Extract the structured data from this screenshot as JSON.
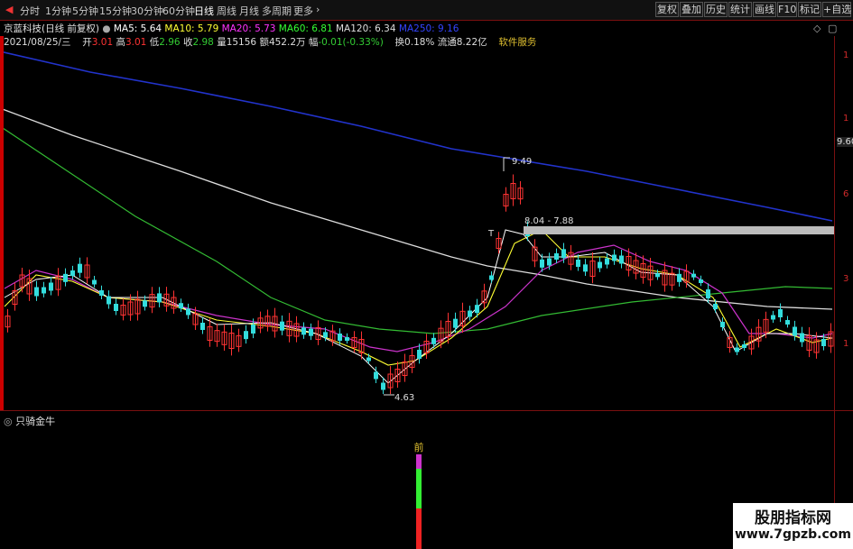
{
  "toolbar": {
    "timeframes": [
      "分时",
      "1分钟",
      "5分钟",
      "15分钟",
      "30分钟",
      "60分钟",
      "日线",
      "周线",
      "月线",
      "多周期",
      "更多"
    ],
    "active": "日线",
    "right_buttons": [
      "复权",
      "叠加",
      "历史",
      "统计",
      "画线",
      "F10",
      "标记",
      "+自选"
    ]
  },
  "info": {
    "title": "京蓝科技(日线 前复权)",
    "ma": [
      {
        "text": "MA5: 5.64",
        "color": "#ffffff"
      },
      {
        "text": "MA10: 5.79",
        "color": "#ffff33"
      },
      {
        "text": "MA20: 5.73",
        "color": "#ff33ff"
      },
      {
        "text": "MA60: 6.81",
        "color": "#33ff33"
      },
      {
        "text": "MA120: 6.34",
        "color": "#dddddd"
      },
      {
        "text": "MA250: 9.16",
        "color": "#3344ff"
      }
    ],
    "date": "2021/08/25/三",
    "open": {
      "label": "开",
      "value": "3.01",
      "color": "#ff3333"
    },
    "high": {
      "label": "高",
      "value": "3.01",
      "color": "#ff3333"
    },
    "low": {
      "label": "低",
      "value": "2.96",
      "color": "#33cc33"
    },
    "close": {
      "label": "收",
      "value": "2.98",
      "color": "#33cc33"
    },
    "volume": {
      "label": "量",
      "value": "15156",
      "color": "#dddddd"
    },
    "amount": {
      "label": "额",
      "value": "452.2万",
      "color": "#dddddd"
    },
    "change": {
      "label": "幅",
      "value": "-0.01(-0.33%)",
      "color": "#33cc33"
    },
    "turnover": {
      "label": "换",
      "value": "0.18%",
      "color": "#dddddd"
    },
    "float": {
      "label": "流通",
      "value": "8.22亿",
      "color": "#dddddd"
    },
    "service": "软件服务"
  },
  "axis": {
    "right_ticks": [
      "1",
      "1",
      "9.60",
      "6",
      "3",
      "1"
    ]
  },
  "annotations": {
    "peak": "9.49",
    "low": "4.63",
    "range": "8.04 - 7.88",
    "t_mark": "T"
  },
  "sub": {
    "title": "只骑金牛",
    "signal_label": "前"
  },
  "colors": {
    "up": "#ff3333",
    "down": "#33dddd",
    "ma5": "#ffffff",
    "ma10": "#ffff33",
    "ma20": "#cc33cc",
    "ma60": "#33bb33",
    "ma120": "#dddddd",
    "ma250": "#2233cc"
  },
  "watermark": {
    "line1": "股朋指标网",
    "line2": "www.7gpzb.com"
  }
}
